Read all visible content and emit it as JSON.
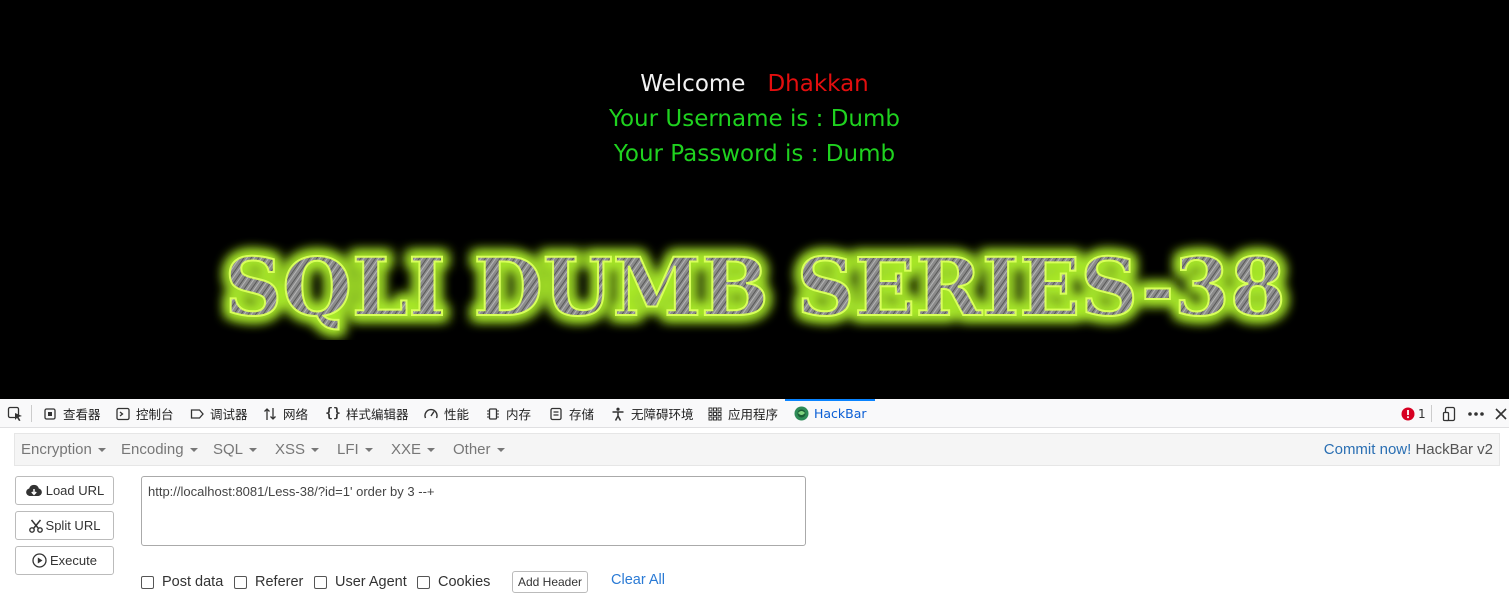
{
  "page": {
    "welcome_word": "Welcome",
    "welcome_name": "Dhakkan",
    "username_line": "Your Username is : Dumb",
    "password_line": "Your Password is : Dumb",
    "banner_text": "SQLI DUMB SERIES-38"
  },
  "devtools": {
    "tabs": [
      {
        "label": "查看器",
        "icon": "inspector-icon"
      },
      {
        "label": "控制台",
        "icon": "console-icon"
      },
      {
        "label": "调试器",
        "icon": "debugger-icon"
      },
      {
        "label": "网络",
        "icon": "network-icon"
      },
      {
        "label": "样式编辑器",
        "icon": "style-editor-icon"
      },
      {
        "label": "性能",
        "icon": "performance-icon"
      },
      {
        "label": "内存",
        "icon": "memory-icon"
      },
      {
        "label": "存储",
        "icon": "storage-icon"
      },
      {
        "label": "无障碍环境",
        "icon": "accessibility-icon"
      },
      {
        "label": "应用程序",
        "icon": "application-icon"
      },
      {
        "label": "HackBar",
        "icon": "hackbar-icon"
      }
    ],
    "error_count": "1",
    "colors": {
      "active_tab": "#0a5ed5",
      "error": "#d70022"
    }
  },
  "hackbar": {
    "menu": [
      "Encryption",
      "Encoding",
      "SQL",
      "XSS",
      "LFI",
      "XXE",
      "Other"
    ],
    "commit_link": "Commit now!",
    "version": "HackBar v2",
    "buttons": {
      "load": "Load URL",
      "split": "Split URL",
      "execute": "Execute"
    },
    "url_value": "http://localhost:8081/Less-38/?id=1' order by 3 --+",
    "options": {
      "post": "Post data",
      "referer": "Referer",
      "user_agent": "User Agent",
      "cookies": "Cookies"
    },
    "add_header": "Add Header",
    "clear_all": "Clear All"
  }
}
